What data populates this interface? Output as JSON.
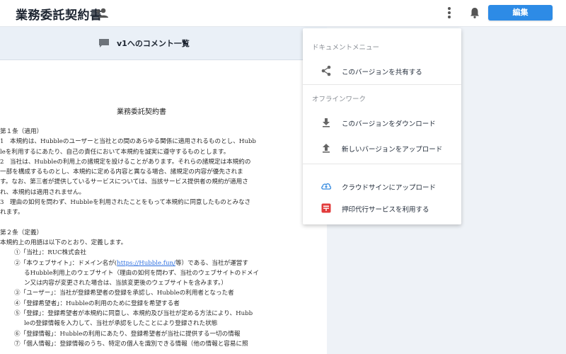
{
  "header": {
    "title": "業務委託契約書",
    "edit_label": "編集"
  },
  "comment_bar": {
    "label": "v1へのコメント一覧"
  },
  "document": {
    "heading": "業務委託契約書",
    "lines": [
      "第１条（適用）",
      "1　本規約は、Hubbleのユーザーと当社との間のあらゆる関係に適用されるものとし、Hubb",
      "leを利用するにあたり、自己の責任において本規約を誠実に遵守するものとします。",
      "2　当社は、Hubbleの利用上の諸規定を設けることがあります。それらの諸規定は本規約の",
      "一部を構成するものとし、本規約に定める内容と異なる場合、諸規定の内容が優先されま",
      "す。なお、第三者が提供しているサービスについては、当該サービス提供者の規約が適用さ",
      "れ、本規約は適用されません。",
      "3　理由の如何を問わず、Hubbleを利用されたことをもって本規約に同意したものとみなさ",
      "れます。",
      "",
      "第２条（定義）",
      "本規約上の用語は以下のとおり、定義します。"
    ],
    "def_1": "①「当社」：RUC株式会社",
    "def_2_pre": "②「本ウェブサイト」：ドメイン名が(",
    "def_2_link": "https://Hubble.fun/",
    "def_2_post": "等）である、当社が運営す",
    "def_lines": [
      "るHubble利用上のウェブサイト（理由の如何を問わず、当社のウェブサイトのドメイ",
      "ン又は内容が変更された場合は、当該変更後のウェブサイトを含みます。）",
      "③「ユーザー」：当社が登録希望者の登録を承認し、Hubbleの利用者となった者",
      "④「登録希望者」：Hubbleの利用のために登録を希望する者",
      "⑤「登録」：登録希望者が本規約に同意し、本規約及び当社が定める方法により、Hubb",
      "leの登録情報を入力して、当社が承認をしたことにより登録された状態",
      "⑥「登録情報」：Hubbleの利用にあたり、登録希望者が当社に提供する一切の情報",
      "⑦「個人情報」：登録情報のうち、特定の個人を識別できる情報（他の情報と容易に照"
    ]
  },
  "menu": {
    "section_1": "ドキュメントメニュー",
    "share": "このバージョンを共有する",
    "section_2": "オフラインワーク",
    "download": "このバージョンをダウンロード",
    "upload": "新しいバージョンをアップロード",
    "cloudsign": "クラウドサインにアップロード",
    "stamp": "押印代行サービスを利用する"
  },
  "colors": {
    "primary": "#2d8be6",
    "stamp_red": "#e23b3b",
    "cloud_blue": "#3a8de0"
  },
  "icons": [
    "share-person-icon",
    "more-vert-icon",
    "bell-icon",
    "comment-icon",
    "share-icon",
    "download-icon",
    "upload-icon",
    "cloud-upload-icon",
    "stamp-icon"
  ]
}
